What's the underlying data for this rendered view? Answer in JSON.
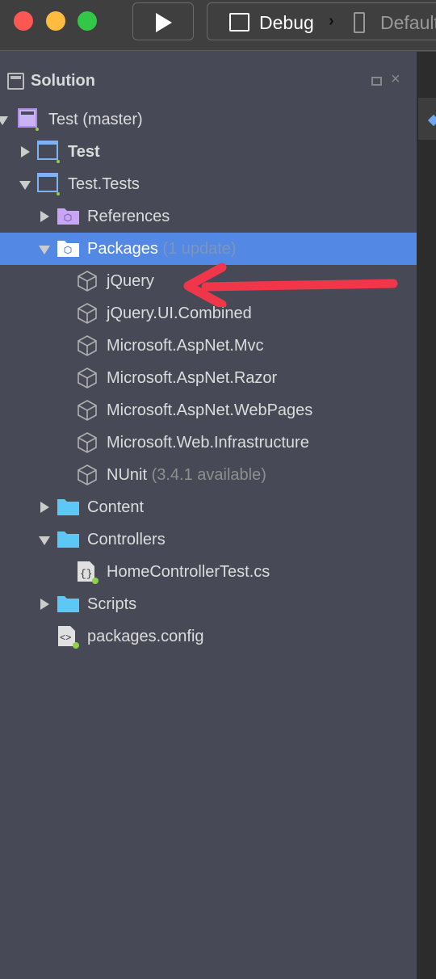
{
  "toolbar": {
    "config": "Debug",
    "separator": "›",
    "device": "Default"
  },
  "panel": {
    "title": "Solution"
  },
  "tree": [
    {
      "label": "Test (master)",
      "note": "",
      "level": 0,
      "expand": "o",
      "icon": "solution-icon",
      "bold": false
    },
    {
      "label": "Test",
      "note": "",
      "level": 1,
      "expand": "c",
      "icon": "project-icon",
      "bold": true
    },
    {
      "label": "Test.Tests",
      "note": "",
      "level": 1,
      "expand": "o",
      "icon": "project-icon",
      "bold": false
    },
    {
      "label": "References",
      "note": "",
      "level": 2,
      "expand": "c",
      "icon": "references-folder-icon",
      "bold": false
    },
    {
      "label": "Packages",
      "note": "(1 update)",
      "level": 2,
      "expand": "o",
      "icon": "packages-folder-icon",
      "bold": false,
      "selected": true
    },
    {
      "label": "jQuery",
      "note": "",
      "level": 3,
      "icon": "package-icon"
    },
    {
      "label": "jQuery.UI.Combined",
      "note": "",
      "level": 3,
      "icon": "package-icon"
    },
    {
      "label": "Microsoft.AspNet.Mvc",
      "note": "",
      "level": 3,
      "icon": "package-icon"
    },
    {
      "label": "Microsoft.AspNet.Razor",
      "note": "",
      "level": 3,
      "icon": "package-icon"
    },
    {
      "label": "Microsoft.AspNet.WebPages",
      "note": "",
      "level": 3,
      "icon": "package-icon"
    },
    {
      "label": "Microsoft.Web.Infrastructure",
      "note": "",
      "level": 3,
      "icon": "package-icon"
    },
    {
      "label": "NUnit",
      "note": "(3.4.1 available)",
      "level": 3,
      "icon": "package-icon"
    },
    {
      "label": "Content",
      "note": "",
      "level": 2,
      "expand": "c",
      "icon": "folder-icon"
    },
    {
      "label": "Controllers",
      "note": "",
      "level": 2,
      "expand": "o",
      "icon": "folder-icon"
    },
    {
      "label": "HomeControllerTest.cs",
      "note": "",
      "level": 3,
      "icon": "csharp-file-icon"
    },
    {
      "label": "Scripts",
      "note": "",
      "level": 2,
      "expand": "c",
      "icon": "folder-icon"
    },
    {
      "label": "packages.config",
      "note": "",
      "level": 2,
      "icon": "config-file-icon"
    }
  ],
  "colors": {
    "selection": "#5389e4",
    "arrow": "#f2364a"
  }
}
